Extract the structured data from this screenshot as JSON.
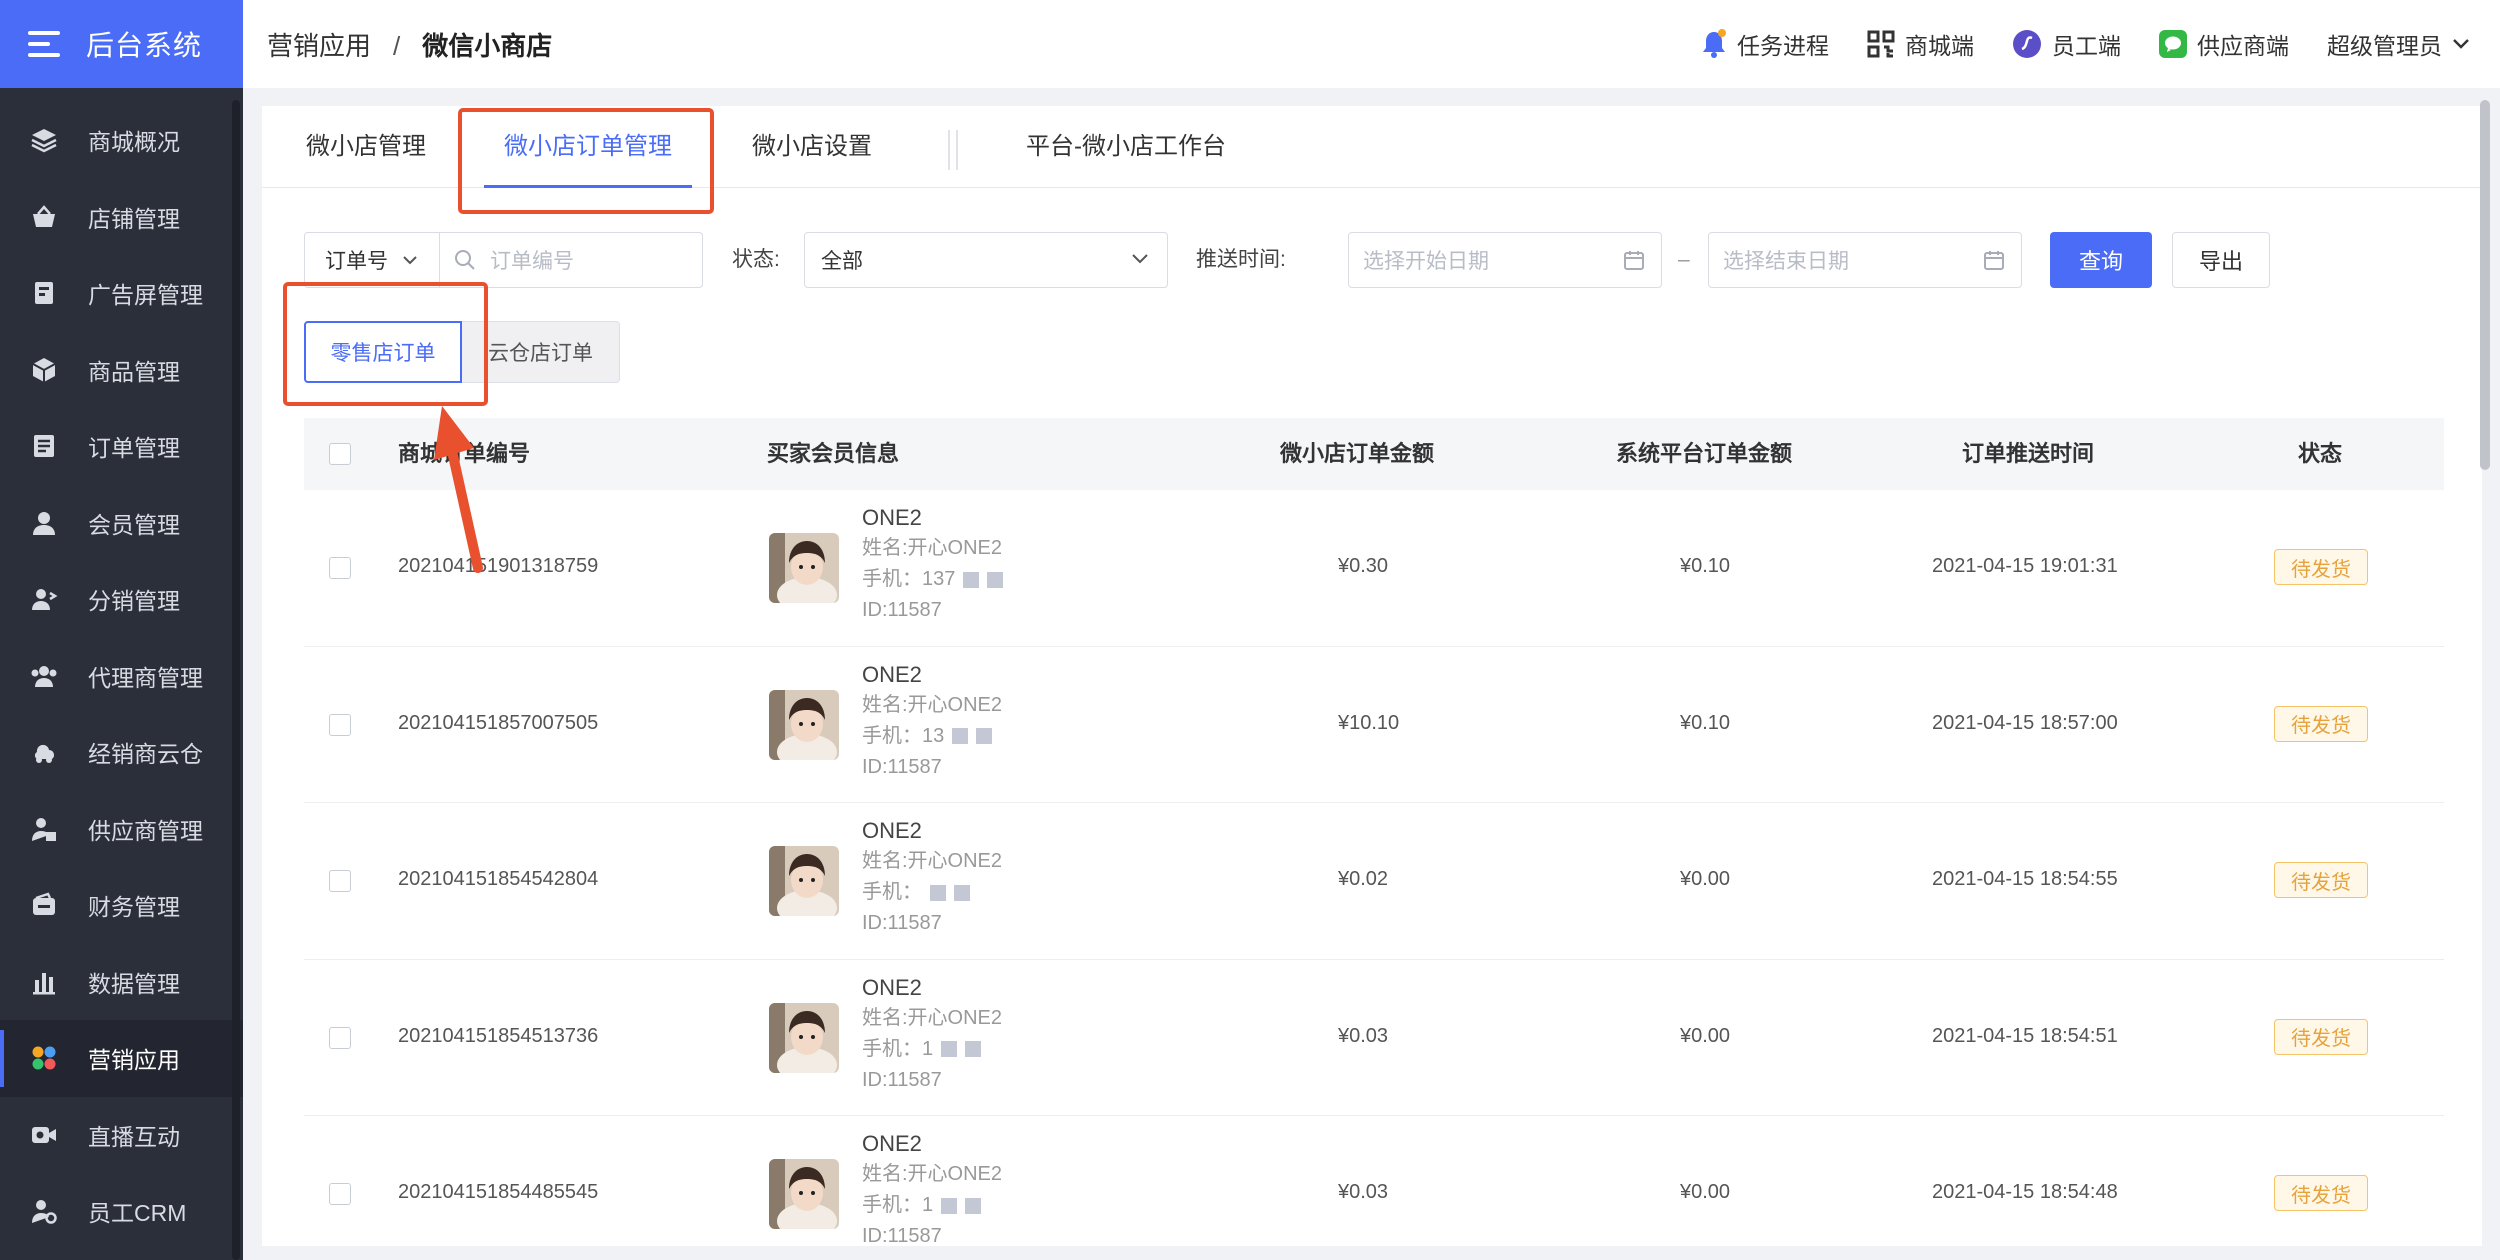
{
  "app": {
    "title": "后台系统"
  },
  "sidebar": {
    "items": [
      {
        "label": "商城概况",
        "icon": "layers-icon"
      },
      {
        "label": "店铺管理",
        "icon": "basket-icon"
      },
      {
        "label": "广告屏管理",
        "icon": "screen-icon"
      },
      {
        "label": "商品管理",
        "icon": "box-icon"
      },
      {
        "label": "订单管理",
        "icon": "document-icon"
      },
      {
        "label": "会员管理",
        "icon": "user-icon"
      },
      {
        "label": "分销管理",
        "icon": "share-user-icon"
      },
      {
        "label": "代理商管理",
        "icon": "group-icon"
      },
      {
        "label": "经销商云仓",
        "icon": "cloud-warehouse-icon"
      },
      {
        "label": "供应商管理",
        "icon": "supplier-icon"
      },
      {
        "label": "财务管理",
        "icon": "wallet-icon"
      },
      {
        "label": "数据管理",
        "icon": "bar-chart-icon"
      },
      {
        "label": "营销应用",
        "icon": "apps-icon"
      },
      {
        "label": "直播互动",
        "icon": "video-icon"
      },
      {
        "label": "员工CRM",
        "icon": "crm-user-icon"
      }
    ],
    "active_index": 12
  },
  "header": {
    "breadcrumb": [
      "营销应用",
      "微信小商店"
    ],
    "breadcrumb_sep": "/",
    "right": {
      "task": "任务进程",
      "mall": "商城端",
      "staff": "员工端",
      "supplier": "供应商端",
      "admin": "超级管理员"
    }
  },
  "tabs": [
    {
      "label": "微小店管理"
    },
    {
      "label": "微小店订单管理",
      "active": true
    },
    {
      "label": "微小店设置"
    },
    {
      "label": "平台-微小店工作台"
    }
  ],
  "filters": {
    "order_type_select": "订单号",
    "order_no_placeholder": "订单编号",
    "status_label": "状态:",
    "status_value": "全部",
    "push_time_label": "推送时间:",
    "start_placeholder": "选择开始日期",
    "date_sep": "–",
    "end_placeholder": "选择结束日期",
    "query_btn": "查询",
    "export_btn": "导出"
  },
  "segment": {
    "retail": "零售店订单",
    "cloud": "云仓店订单"
  },
  "table": {
    "columns": [
      "商城订单编号",
      "买家会员信息",
      "微小店订单金额",
      "系统平台订单金额",
      "订单推送时间",
      "状态"
    ],
    "rows": [
      {
        "order_no": "202104151901318759",
        "buyer_name": "ONE2",
        "buyer_realname": "姓名:开心ONE2",
        "buyer_phone": "手机：137",
        "buyer_id": "ID:11587",
        "wx_amount": "¥0.30",
        "sys_amount": "¥0.10",
        "push_time": "2021-04-15 19:01:31",
        "status": "待发货"
      },
      {
        "order_no": "202104151857007505",
        "buyer_name": "ONE2",
        "buyer_realname": "姓名:开心ONE2",
        "buyer_phone": "手机：13",
        "buyer_id": "ID:11587",
        "wx_amount": "¥10.10",
        "sys_amount": "¥0.10",
        "push_time": "2021-04-15 18:57:00",
        "status": "待发货"
      },
      {
        "order_no": "202104151854542804",
        "buyer_name": "ONE2",
        "buyer_realname": "姓名:开心ONE2",
        "buyer_phone": "手机：",
        "buyer_id": "ID:11587",
        "wx_amount": "¥0.02",
        "sys_amount": "¥0.00",
        "push_time": "2021-04-15 18:54:55",
        "status": "待发货"
      },
      {
        "order_no": "202104151854513736",
        "buyer_name": "ONE2",
        "buyer_realname": "姓名:开心ONE2",
        "buyer_phone": "手机：1",
        "buyer_id": "ID:11587",
        "wx_amount": "¥0.03",
        "sys_amount": "¥0.00",
        "push_time": "2021-04-15 18:54:51",
        "status": "待发货"
      },
      {
        "order_no": "202104151854485545",
        "buyer_name": "ONE2",
        "buyer_realname": "姓名:开心ONE2",
        "buyer_phone": "手机：1",
        "buyer_id": "ID:11587",
        "wx_amount": "¥0.03",
        "sys_amount": "¥0.00",
        "push_time": "2021-04-15 18:54:48",
        "status": "待发货"
      }
    ]
  },
  "colors": {
    "primary": "#4a6cf7",
    "sidebar_bg": "#2b2f3a",
    "annotation": "#e8502e",
    "status_warn": "#e6a23c"
  }
}
